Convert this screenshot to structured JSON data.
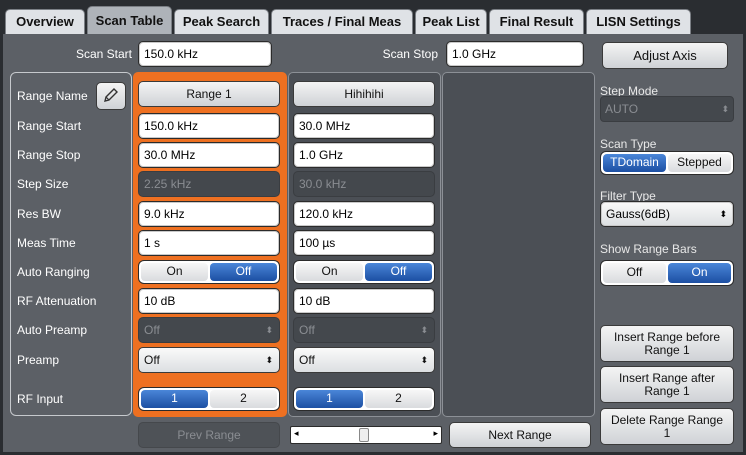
{
  "tabs": [
    {
      "label": "Overview",
      "active": false
    },
    {
      "label": "Scan Table",
      "active": true
    },
    {
      "label": "Peak Search",
      "active": false
    },
    {
      "label": "Traces / Final Meas",
      "active": false
    },
    {
      "label": "Peak List",
      "active": false
    },
    {
      "label": "Final Result",
      "active": false
    },
    {
      "label": "LISN Settings",
      "active": false
    }
  ],
  "scan": {
    "start_label": "Scan Start",
    "start_value": "150.0 kHz",
    "stop_label": "Scan Stop",
    "stop_value": "1.0 GHz",
    "adjust_axis": "Adjust Axis"
  },
  "row_labels": {
    "range_name": "Range Name",
    "range_start": "Range Start",
    "range_stop": "Range Stop",
    "step_size": "Step Size",
    "res_bw": "Res BW",
    "meas_time": "Meas Time",
    "auto_ranging": "Auto Ranging",
    "rf_attenuation": "RF Attenuation",
    "auto_preamp": "Auto Preamp",
    "preamp": "Preamp",
    "rf_input": "RF Input"
  },
  "ranges": [
    {
      "name": "Range 1",
      "start": "150.0 kHz",
      "stop": "30.0 MHz",
      "step": "2.25 kHz",
      "res_bw": "9.0 kHz",
      "meas_time": "1 s",
      "auto_on": "On",
      "auto_off": "Off",
      "auto_selected": "Off",
      "rf_att": "10 dB",
      "auto_preamp": "Off",
      "preamp": "Off",
      "rf_in_1": "1",
      "rf_in_2": "2",
      "rf_in_selected": "1"
    },
    {
      "name": "Hihihihi",
      "start": "30.0 MHz",
      "stop": "1.0 GHz",
      "step": "30.0 kHz",
      "res_bw": "120.0 kHz",
      "meas_time": "100 µs",
      "auto_on": "On",
      "auto_off": "Off",
      "auto_selected": "Off",
      "rf_att": "10 dB",
      "auto_preamp": "Off",
      "preamp": "Off",
      "rf_in_1": "1",
      "rf_in_2": "2",
      "rf_in_selected": "1"
    }
  ],
  "right": {
    "step_mode_label": "Step Mode",
    "step_mode_value": "AUTO",
    "scan_type_label": "Scan Type",
    "scan_type_opt1": "TDomain",
    "scan_type_opt2": "Stepped",
    "scan_type_selected": "TDomain",
    "filter_type_label": "Filter Type",
    "filter_type_value": "Gauss(6dB)",
    "show_range_bars_label": "Show Range Bars",
    "srb_off": "Off",
    "srb_on": "On",
    "srb_selected": "On",
    "insert_before": "Insert Range before Range 1",
    "insert_after": "Insert Range after Range 1",
    "delete_range": "Delete Range Range 1"
  },
  "nav": {
    "prev": "Prev Range",
    "next": "Next Range"
  },
  "colors": {
    "highlight": "#ee7021",
    "toggle_on": "#1c4fa3",
    "panel": "#5c6066"
  }
}
